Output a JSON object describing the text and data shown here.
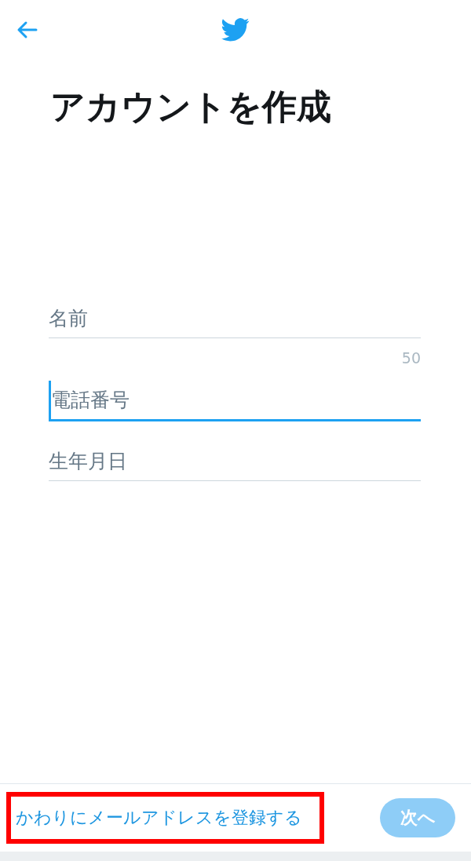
{
  "header": {
    "title": "アカウントを作成"
  },
  "fields": [
    {
      "placeholder": "名前",
      "selected": false,
      "counter": "50"
    },
    {
      "placeholder": "電話番号",
      "selected": true
    },
    {
      "placeholder": "生年月日",
      "selected": false
    }
  ],
  "footer": {
    "link": "かわりにメールアドレスを登録する",
    "highlighted": true,
    "next_button": {
      "label": "次へ",
      "disabled": true
    }
  }
}
